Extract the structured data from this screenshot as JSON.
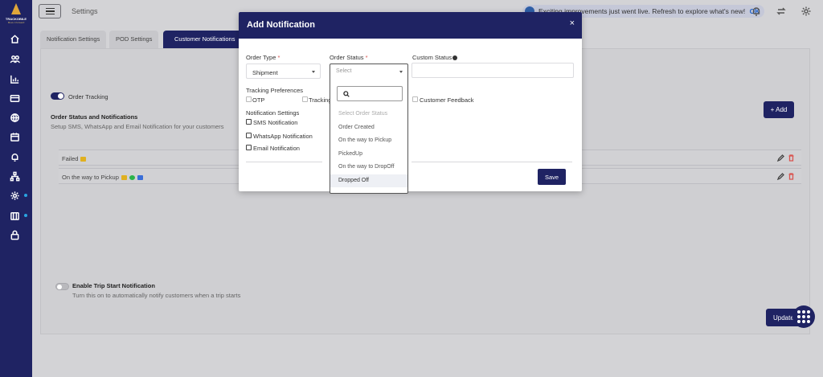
{
  "brand": {
    "name": "TRACKOBILE",
    "tagline": "Move it forward"
  },
  "colors": {
    "primary": "#1f2363",
    "accent": "#e0a63a",
    "danger": "#d9534f",
    "link": "#2061c8"
  },
  "sidebar": {
    "items": [
      {
        "icon": "home-icon"
      },
      {
        "icon": "users-icon"
      },
      {
        "icon": "chart-icon"
      },
      {
        "icon": "card-icon"
      },
      {
        "icon": "globe-icon"
      },
      {
        "icon": "calendar-icon"
      },
      {
        "icon": "bell-icon"
      },
      {
        "icon": "hierarchy-icon"
      },
      {
        "icon": "gear-icon"
      },
      {
        "icon": "book-icon"
      },
      {
        "icon": "lock-icon"
      }
    ]
  },
  "topbar": {
    "title": "Settings",
    "notice_text": "Exciting improvements just went live. Refresh to explore what's new!",
    "notice_ok": "OK",
    "icons": [
      "bell-icon",
      "sync-icon",
      "gear-icon"
    ]
  },
  "tabs": [
    {
      "label": "Notification Settings",
      "active": false
    },
    {
      "label": "POD Settings",
      "active": false
    },
    {
      "label": "Customer Notifications",
      "active": true
    }
  ],
  "panel": {
    "order_tracking_label": "Order Tracking",
    "order_tracking_on": true,
    "section_title": "Order Status and Notifications",
    "section_desc": "Setup SMS, WhatsApp and Email Notification for your customers",
    "add_label": "+ Add",
    "rows": [
      {
        "label": "Failed"
      },
      {
        "label": "On the way to Pickup"
      }
    ],
    "trip_toggle_label": "Enable Trip Start Notification",
    "trip_toggle_on": false,
    "trip_desc": "Turn this on to automatically notify customers when a trip starts",
    "update_label": "Update"
  },
  "modal": {
    "title": "Add Notification",
    "close": "×",
    "order_type_label": "Order Type",
    "order_type_value": "Shipment",
    "order_status_label": "Order Status",
    "order_status_placeholder": "Select",
    "custom_status_label": "Custom Status",
    "required_mark": "*",
    "tracking_prefs_label": "Tracking Preferences",
    "otp_label": "OTP",
    "tracking_label": "Tracking",
    "customer_feedback_label": "Customer Feedback",
    "notification_settings_label": "Notification Settings",
    "sms_label": "SMS Notification",
    "whatsapp_label": "WhatsApp Notification",
    "email_label": "Email Notification",
    "save_label": "Save"
  },
  "dropdown": {
    "options": [
      "Select Order Status",
      "Order Created",
      "On the way to Pickup",
      "PickedUp",
      "On the way to DropOff",
      "Dropped Off"
    ]
  }
}
